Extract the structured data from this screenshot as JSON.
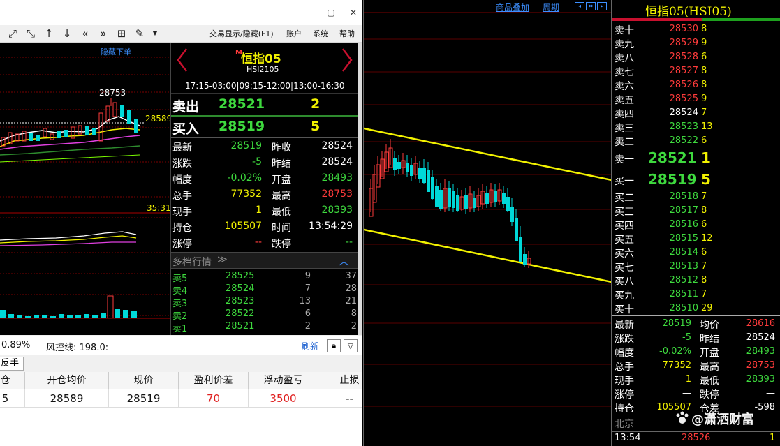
{
  "window": {
    "close_glyph": "✕",
    "max_glyph": "▢",
    "min_glyph": "—"
  },
  "toolbar": {
    "icons": [
      "expand-icon",
      "shrink-icon",
      "arrow-up-icon",
      "arrow-down-icon",
      "double-left-icon",
      "double-right-icon",
      "grid-icon",
      "pen-icon",
      "dropdown-icon"
    ],
    "menu": [
      "交易显示/隐藏(F1)",
      "账户",
      "系统",
      "帮助"
    ]
  },
  "left_chart": {
    "hide_order_label": "隐藏下单",
    "high_label": "28753",
    "price_tag": "28589",
    "time_tag": "35:31"
  },
  "quote": {
    "badge": "M",
    "symbol": "恒指05",
    "code": "HSI2105",
    "sessions": "17:15-03:00|09:15-12:00|13:00-16:30",
    "sell_label": "卖出",
    "sell_price": "28521",
    "sell_qty": "2",
    "buy_label": "买入",
    "buy_price": "28519",
    "buy_qty": "5",
    "rows": [
      {
        "l1": "最新",
        "v1": "28519",
        "c1": "green",
        "l2": "昨收",
        "v2": "28524",
        "c2": "white"
      },
      {
        "l1": "涨跌",
        "v1": "-5",
        "c1": "green",
        "l2": "昨结",
        "v2": "28524",
        "c2": "white"
      },
      {
        "l1": "幅度",
        "v1": "-0.02%",
        "c1": "green",
        "l2": "开盘",
        "v2": "28493",
        "c2": "green"
      },
      {
        "l1": "总手",
        "v1": "77352",
        "c1": "yellow",
        "l2": "最高",
        "v2": "28753",
        "c2": "red"
      },
      {
        "l1": "现手",
        "v1": "1",
        "c1": "yellow",
        "l2": "最低",
        "v2": "28393",
        "c2": "green"
      },
      {
        "l1": "持仓",
        "v1": "105507",
        "c1": "yellow",
        "l2": "时间",
        "v2": "13:54:29",
        "c2": "white"
      },
      {
        "l1": "涨停",
        "v1": "--",
        "c1": "red",
        "l2": "跌停",
        "v2": "--",
        "c2": "green"
      }
    ],
    "depth_title": "多档行情",
    "depth": [
      {
        "label": "卖5",
        "price": "28525",
        "q1": "9",
        "q2": "37"
      },
      {
        "label": "卖4",
        "price": "28524",
        "q1": "7",
        "q2": "28"
      },
      {
        "label": "卖3",
        "price": "28523",
        "q1": "13",
        "q2": "21"
      },
      {
        "label": "卖2",
        "price": "28522",
        "q1": "6",
        "q2": "8"
      },
      {
        "label": "卖1",
        "price": "28521",
        "q1": "2",
        "q2": "2"
      }
    ]
  },
  "status": {
    "pct": "0.89%",
    "risk": "风控线: 198.0:",
    "refresh": "刷新"
  },
  "positions": {
    "tab": "反手",
    "headers": [
      "仓",
      "开仓均价",
      "现价",
      "盈利价差",
      "浮动盈亏",
      "止损"
    ],
    "row": [
      "5",
      "28589",
      "28519",
      "70",
      "3500",
      "--"
    ]
  },
  "mid": {
    "toolbar_text1": "商品叠加",
    "toolbar_text2": "周期"
  },
  "book": {
    "title": "恒指05(HSI05)",
    "asks": [
      {
        "label": "卖十",
        "price": "28530",
        "color": "red",
        "vol": "8"
      },
      {
        "label": "卖九",
        "price": "28529",
        "color": "red",
        "vol": "9"
      },
      {
        "label": "卖八",
        "price": "28528",
        "color": "red",
        "vol": "6"
      },
      {
        "label": "卖七",
        "price": "28527",
        "color": "red",
        "vol": "8"
      },
      {
        "label": "卖六",
        "price": "28526",
        "color": "red",
        "vol": "8"
      },
      {
        "label": "卖五",
        "price": "28525",
        "color": "red",
        "vol": "9"
      },
      {
        "label": "卖四",
        "price": "28524",
        "color": "white",
        "vol": "7"
      },
      {
        "label": "卖三",
        "price": "28523",
        "color": "green",
        "vol": "13"
      },
      {
        "label": "卖二",
        "price": "28522",
        "color": "green",
        "vol": "6"
      }
    ],
    "ask1": {
      "label": "卖一",
      "price": "28521",
      "vol": "1"
    },
    "bid1": {
      "label": "买一",
      "price": "28519",
      "vol": "5"
    },
    "bids": [
      {
        "label": "买二",
        "price": "28518",
        "vol": "7"
      },
      {
        "label": "买三",
        "price": "28517",
        "vol": "8"
      },
      {
        "label": "买四",
        "price": "28516",
        "vol": "6"
      },
      {
        "label": "买五",
        "price": "28515",
        "vol": "12"
      },
      {
        "label": "买六",
        "price": "28514",
        "vol": "6"
      },
      {
        "label": "买七",
        "price": "28513",
        "vol": "7"
      },
      {
        "label": "买八",
        "price": "28512",
        "vol": "8"
      },
      {
        "label": "买九",
        "price": "28511",
        "vol": "7"
      },
      {
        "label": "买十",
        "price": "28510",
        "vol": "29"
      }
    ],
    "stats": [
      {
        "l1": "最新",
        "v1": "28519",
        "c1": "green",
        "l2": "均价",
        "v2": "28616",
        "c2": "red"
      },
      {
        "l1": "涨跌",
        "v1": "-5",
        "c1": "green",
        "l2": "昨结",
        "v2": "28524",
        "c2": "white"
      },
      {
        "l1": "幅度",
        "v1": "-0.02%",
        "c1": "green",
        "l2": "开盘",
        "v2": "28493",
        "c2": "green"
      },
      {
        "l1": "总手",
        "v1": "77352",
        "c1": "yellow",
        "l2": "最高",
        "v2": "28753",
        "c2": "red"
      },
      {
        "l1": "现手",
        "v1": "1",
        "c1": "yellow",
        "l2": "最低",
        "v2": "28393",
        "c2": "green"
      },
      {
        "l1": "涨停",
        "v1": "—",
        "c1": "white",
        "l2": "跌停",
        "v2": "—",
        "c2": "white"
      },
      {
        "l1": "持仓",
        "v1": "105507",
        "c1": "yellow",
        "l2": "仓差",
        "v2": "-598",
        "c2": "white"
      }
    ],
    "city": "北京",
    "tick_time": "13:54",
    "tick_price": "28526",
    "tick_vol": "1",
    "watermark": "@潇洒财富"
  }
}
